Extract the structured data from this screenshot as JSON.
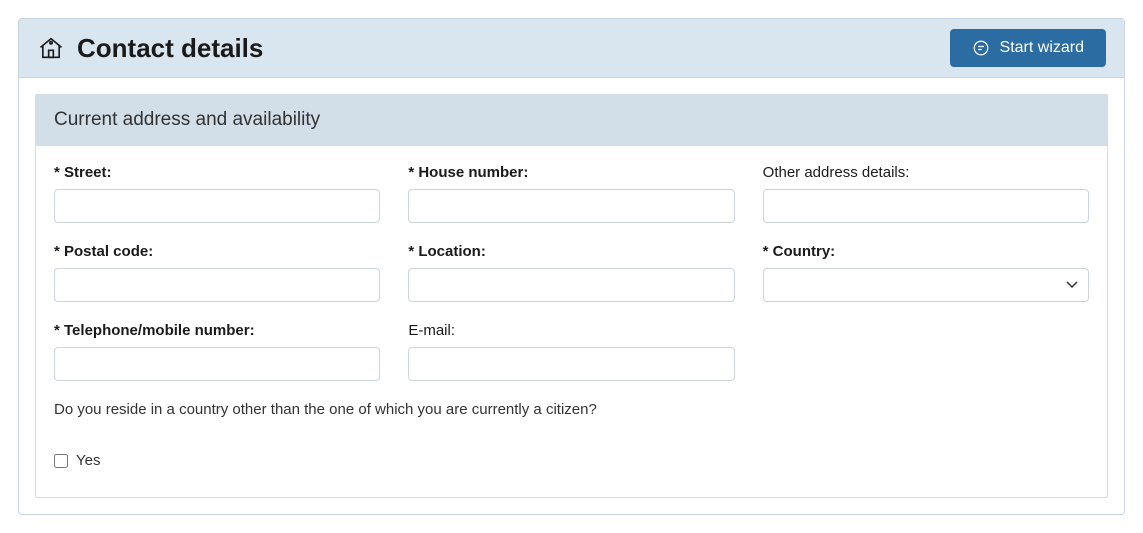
{
  "header": {
    "title": "Contact details",
    "start_wizard": "Start wizard"
  },
  "section": {
    "title": "Current address and availability"
  },
  "fields": {
    "street": {
      "label": "* Street:",
      "value": ""
    },
    "house_number": {
      "label": "* House number:",
      "value": ""
    },
    "other_details": {
      "label": "Other address details:",
      "value": ""
    },
    "postal_code": {
      "label": "* Postal code:",
      "value": ""
    },
    "location": {
      "label": "* Location:",
      "value": ""
    },
    "country": {
      "label": "* Country:",
      "value": ""
    },
    "telephone": {
      "label": "* Telephone/mobile number:",
      "value": ""
    },
    "email": {
      "label": "E-mail:",
      "value": ""
    }
  },
  "question": {
    "text": "Do you reside in a country other than the one of which you are currently a citizen?",
    "yes_label": "Yes"
  }
}
